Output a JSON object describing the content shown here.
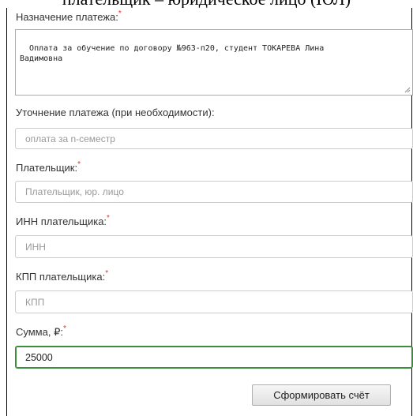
{
  "top_text": "плательщик – юридическое лицо (ЮЛ)",
  "form": {
    "purpose": {
      "label": "Назначение платежа:",
      "required_mark": "*",
      "value": "Оплата за обучение по договору №963-п20, студент ТОКАРЕВА Лина\nВадимовна"
    },
    "clarification": {
      "label": "Уточнение платежа (при необходимости):",
      "placeholder": "оплата за n-семестр"
    },
    "payer": {
      "label": "Плательщик:",
      "required_mark": "*",
      "placeholder": "Плательщик, юр. лицо"
    },
    "inn": {
      "label": "ИНН плательщика:",
      "required_mark": "*",
      "placeholder": "ИНН"
    },
    "kpp": {
      "label": "КПП плательщика:",
      "required_mark": "*",
      "placeholder": "КПП"
    },
    "amount": {
      "label": "Сумма, ₽:",
      "required_mark": "*",
      "value": "25000"
    },
    "submit_label": "Сформировать счёт"
  },
  "colors": {
    "required": "#e5332a",
    "focus_border": "#3c8d3c"
  }
}
